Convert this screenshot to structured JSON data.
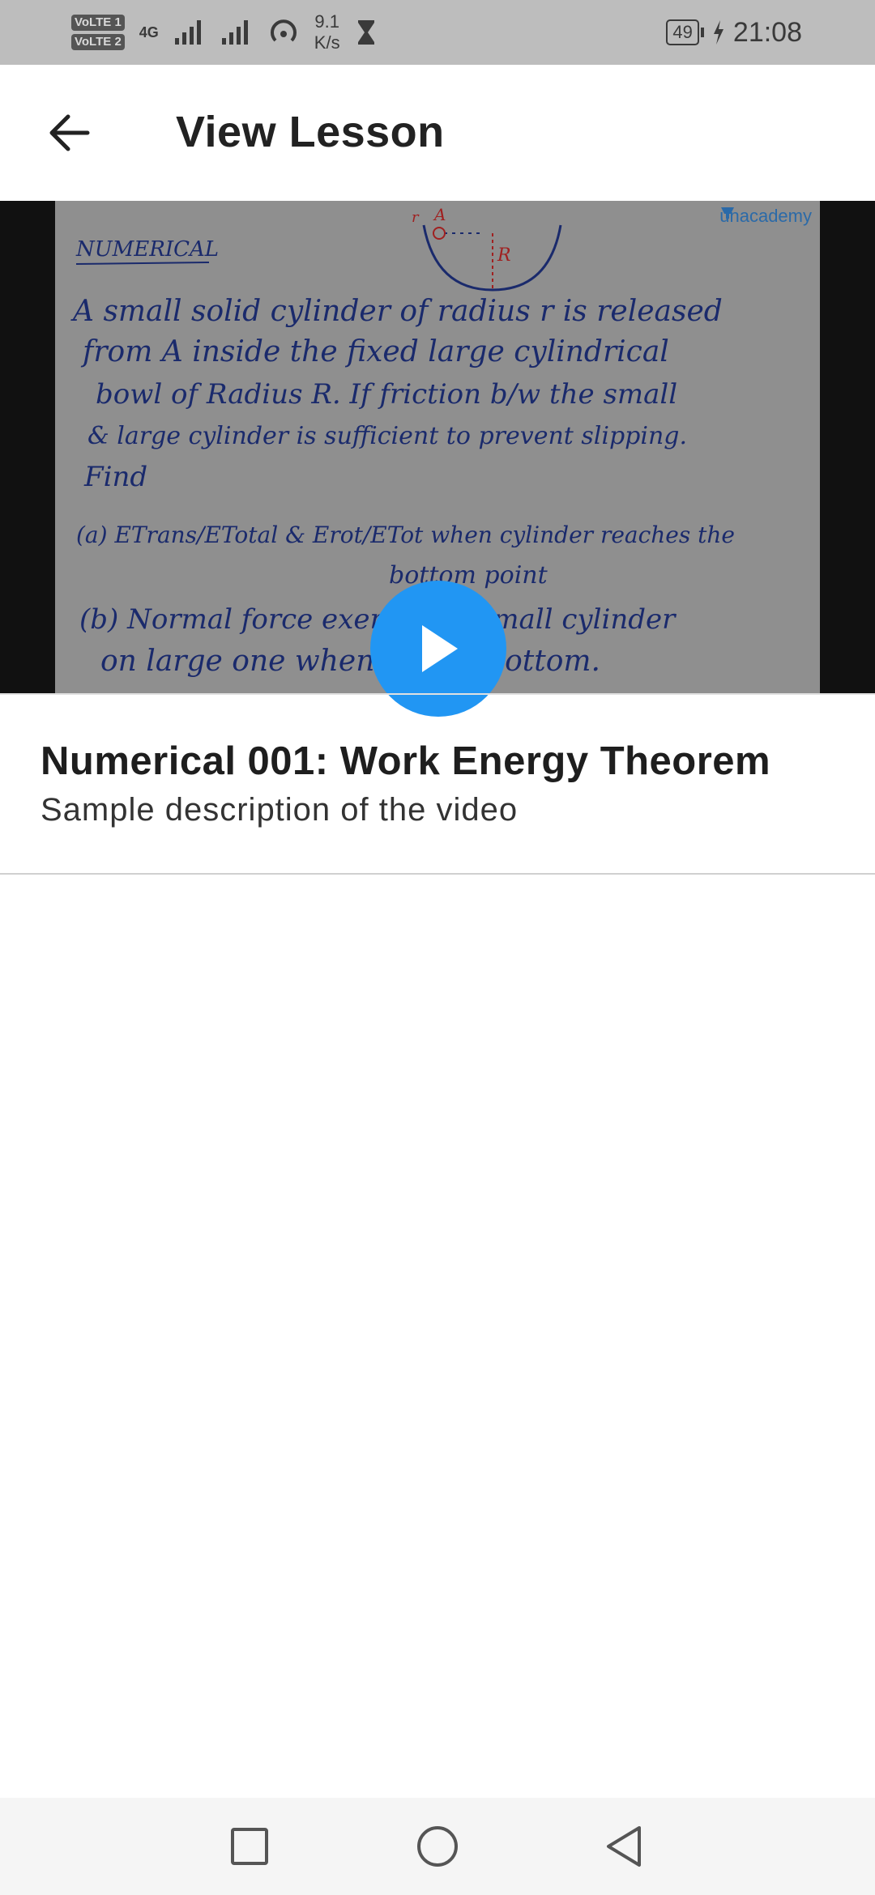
{
  "status_bar": {
    "volte_1": "VoLTE 1",
    "volte_2": "VoLTE 2",
    "network": "4G",
    "speed_value": "9.1",
    "speed_unit": "K/s",
    "battery": "49",
    "time": "21:08"
  },
  "app_bar": {
    "title": "View Lesson",
    "back_icon": "arrow-back-icon"
  },
  "video": {
    "brand": "unacademy",
    "play_icon": "play-icon",
    "thumbnail_lines": [
      "NUMERICAL",
      "A small solid cylinder of radius r is released",
      "from A inside the fixed large cylindrical",
      "bowl of Radius R. If friction b/w the small",
      "& large cylinder is sufficient to prevent slipping.",
      "Find",
      "(a) ETrans/ETotal & Erot/ETot when cylinder reaches the",
      "bottom point",
      "(b) Normal force exerted by small cylinder",
      "on large one when it is at bottom."
    ],
    "diagram_labels": {
      "a": "A",
      "r": "R",
      "small_r": "r"
    }
  },
  "lesson": {
    "title": "Numerical 001: Work Energy Theorem",
    "description": "Sample description of the video"
  },
  "nav_bar": {
    "recents_icon": "square-icon",
    "home_icon": "circle-icon",
    "back_icon": "triangle-back-icon"
  },
  "colors": {
    "accent": "#2196f3",
    "status_bar": "#bdbdbd",
    "ink": "#1a2a6c"
  }
}
